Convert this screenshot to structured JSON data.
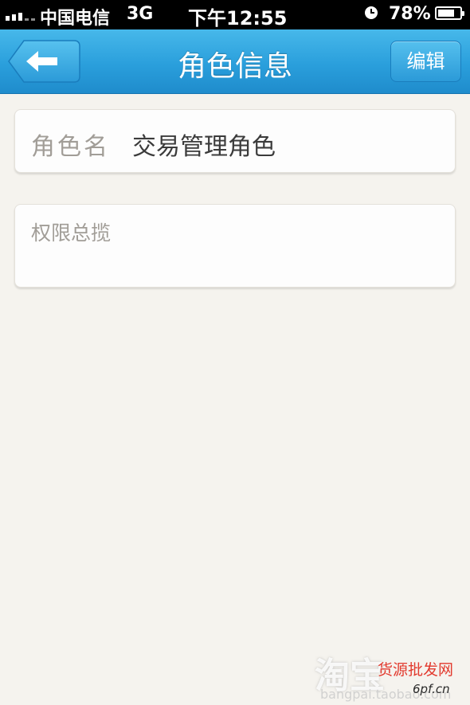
{
  "status_bar": {
    "carrier": "中国电信",
    "network": "3G",
    "time": "下午12:55",
    "battery": "78%",
    "battery_level": 0.78
  },
  "nav": {
    "title": "角色信息",
    "edit_label": "编辑",
    "back_icon": "back-arrow-icon"
  },
  "role": {
    "label": "角色名",
    "value": "交易管理角色"
  },
  "permissions": {
    "label": "权限总揽"
  },
  "watermark": {
    "logo": "淘宝",
    "cn_text": "货源批发网",
    "domain": "6pf.cn",
    "url": "bangpai.taobao.com"
  },
  "colors": {
    "nav_blue": "#2a9fdc",
    "background": "#f5f3ee",
    "label_gray": "#a19d97",
    "value_dark": "#3b3b3b"
  }
}
